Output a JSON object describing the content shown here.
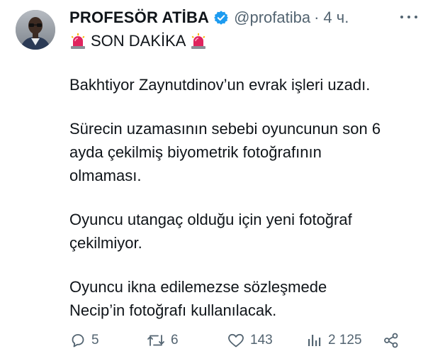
{
  "author": {
    "display_name": "PROFESÖR ATİBA",
    "handle": "@profatiba",
    "separator": "·",
    "time": "4 ч."
  },
  "tweet": {
    "breaking_label": "SON DAKİKA",
    "lines": [
      "Bakhtiyor Zaynutdinov’un evrak işleri uzadı.",
      "Sürecin uzamasının sebebi oyuncunun son 6",
      "ayda çekilmiş biyometrik fotoğrafının",
      "olmaması.",
      "Oyuncu utangaç olduğu için yeni fotoğraf",
      "çekilmiyor.",
      "Oyuncu ikna edilemezse sözleşmede",
      "Necip’in fotoğrafı kullanılacak."
    ]
  },
  "actions": {
    "replies": "5",
    "retweets": "6",
    "likes": "143",
    "views": "2 125"
  },
  "icons": {
    "verified": "verified-badge-icon",
    "siren": "police-siren-icon",
    "more": "more-options-icon",
    "reply": "reply-icon",
    "retweet": "retweet-icon",
    "like": "heart-icon",
    "views": "views-chart-icon",
    "share": "share-icon"
  },
  "colors": {
    "text": "#0f1419",
    "secondary": "#536471",
    "verified": "#1d9bf0",
    "siren_red": "#e0245e"
  }
}
